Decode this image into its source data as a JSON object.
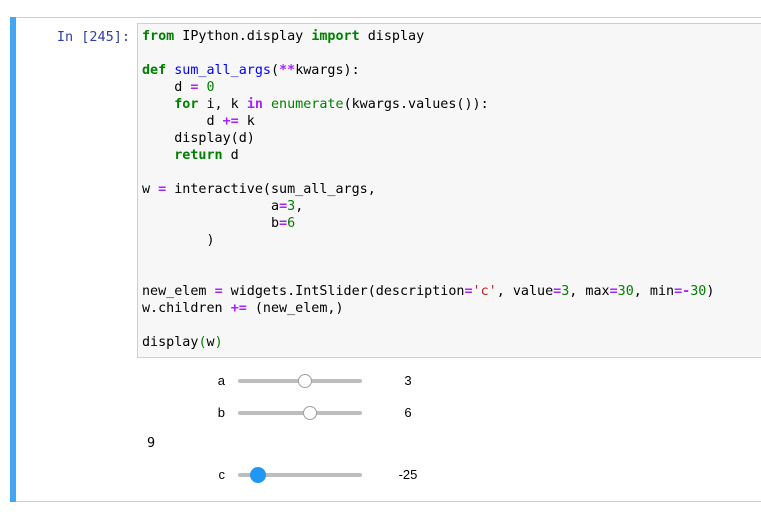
{
  "prompt": "In [245]:",
  "code_lines": [
    "from IPython.display import display",
    "",
    "def sum_all_args(**kwargs):",
    "    d = 0",
    "    for i, k in enumerate(kwargs.values()):",
    "        d += k",
    "    display(d)",
    "    return d",
    "",
    "w = interactive(sum_all_args,",
    "                a=3,",
    "                b=6",
    "        )",
    "",
    "",
    "new_elem = widgets.IntSlider(description='c', value=3, max=30, min=-30)",
    "w.children += (new_elem,)",
    "",
    "display(w)"
  ],
  "sliders": [
    {
      "label": "a",
      "value": "3",
      "min": -30,
      "max": 30,
      "current": 3,
      "focused": false
    },
    {
      "label": "b",
      "value": "6",
      "min": -30,
      "max": 30,
      "current": 6,
      "focused": false
    },
    {
      "label": "c",
      "value": "-25",
      "min": -30,
      "max": 30,
      "current": -25,
      "focused": true
    }
  ],
  "output_value": "9",
  "colors": {
    "accent": "#42a5f5",
    "handle_active": "#2196f3",
    "prompt": "#303f9f"
  }
}
